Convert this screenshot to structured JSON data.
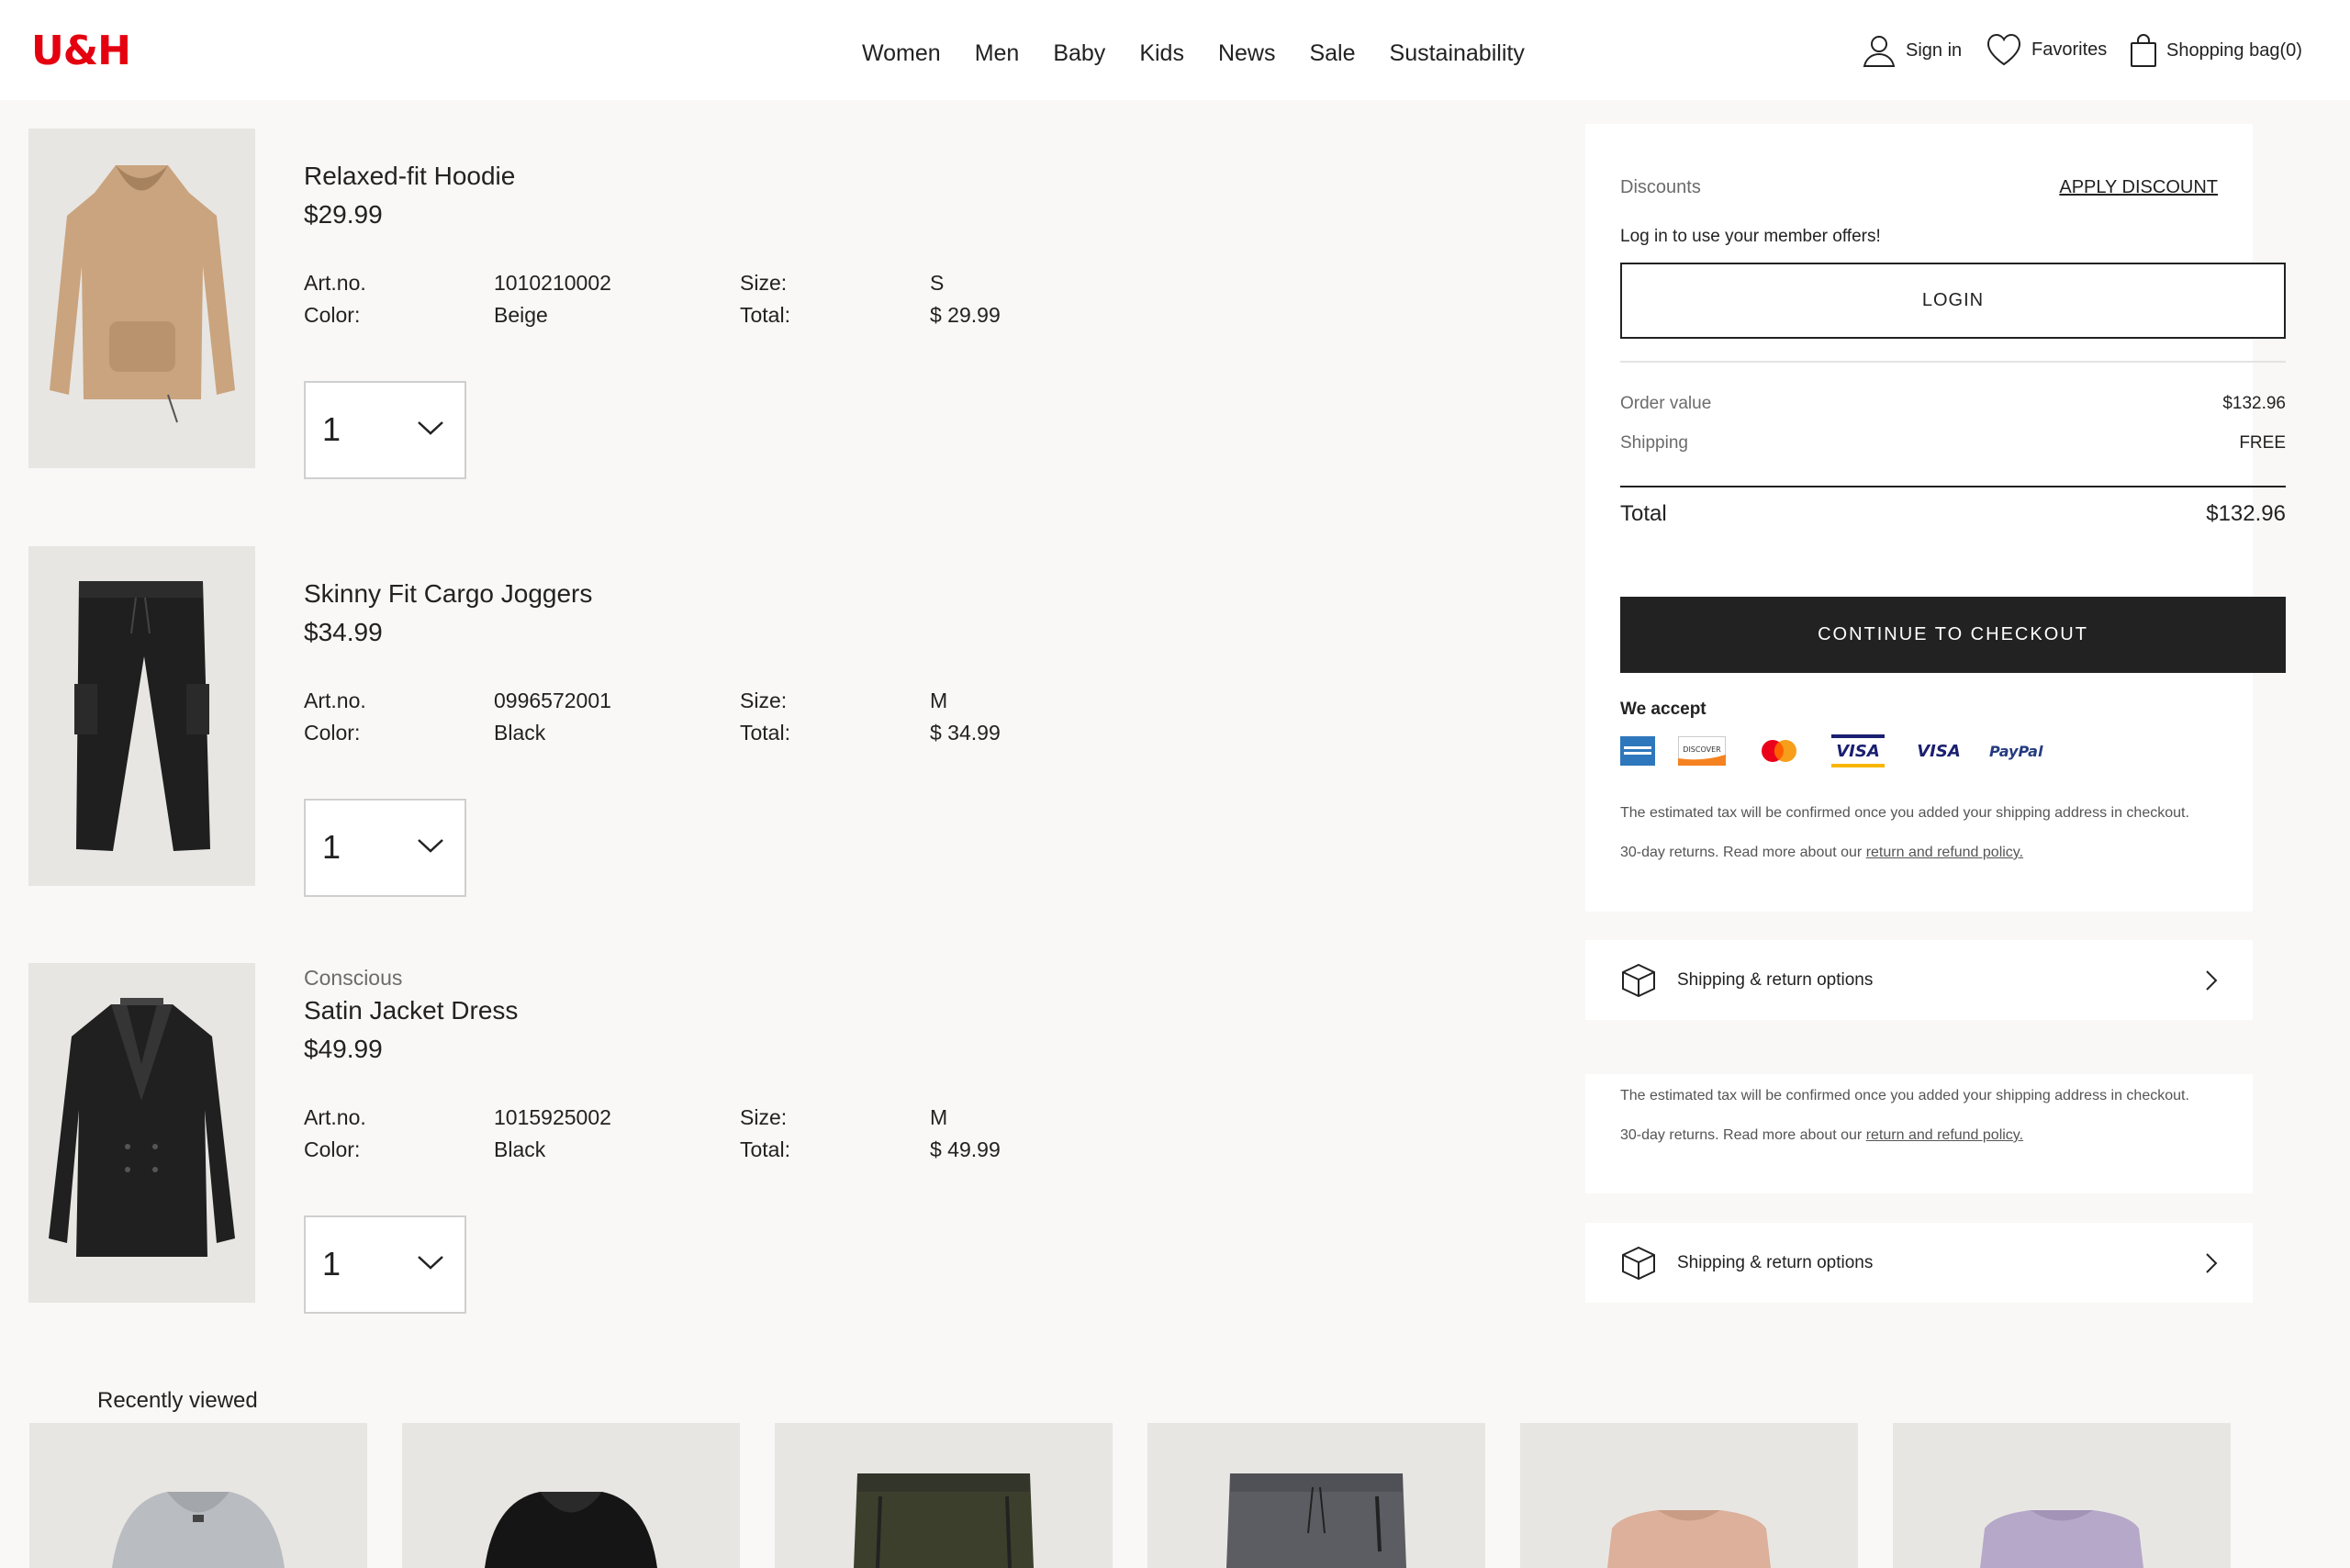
{
  "header": {
    "logo": "U&H",
    "nav": [
      "Women",
      "Men",
      "Baby",
      "Kids",
      "News",
      "Sale",
      "Sustainability"
    ],
    "sign_in": "Sign in",
    "favorites": "Favorites",
    "bag": "Shopping bag(0)"
  },
  "cart": {
    "items": [
      {
        "subtitle": "",
        "name": "Relaxed-fit Hoodie",
        "price": "$29.99",
        "artno_label": "Art.no.",
        "artno": "1010210002",
        "color_label": "Color:",
        "color": "Beige",
        "size_label": "Size:",
        "size": "S",
        "total_label": "Total:",
        "total": "$ 29.99",
        "qty": "1",
        "image_color": "#c9a47e"
      },
      {
        "subtitle": "",
        "name": "Skinny Fit Cargo Joggers",
        "price": "$34.99",
        "artno_label": "Art.no.",
        "artno": "0996572001",
        "color_label": "Color:",
        "color": "Black",
        "size_label": "Size:",
        "size": "M",
        "total_label": "Total:",
        "total": "$ 34.99",
        "qty": "1",
        "image_color": "#1f1f1f"
      },
      {
        "subtitle": "Conscious",
        "name": "Satin Jacket Dress",
        "price": "$49.99",
        "artno_label": "Art.no.",
        "artno": "1015925002",
        "color_label": "Color:",
        "color": "Black",
        "size_label": "Size:",
        "size": "M",
        "total_label": "Total:",
        "total": "$ 49.99",
        "qty": "1",
        "image_color": "#202020"
      }
    ]
  },
  "summary": {
    "discounts_label": "Discounts",
    "apply_discount": "APPLY DISCOUNT",
    "member_text": "Log in to use your member offers!",
    "login": "LOGIN",
    "order_value_label": "Order value",
    "order_value": "$132.96",
    "shipping_label": "Shipping",
    "shipping_value": "FREE",
    "total_label": "Total",
    "total_value": "$132.96",
    "checkout": "CONTINUE TO CHECKOUT",
    "we_accept": "We accept",
    "payment_icons": [
      "amex-icon",
      "discover-icon",
      "mastercard-icon",
      "visa-electron-icon",
      "visa-icon",
      "paypal-icon"
    ],
    "discover_text": "DISCOVER",
    "visa_text": "VISA",
    "paypal_text": "PayPal",
    "tax_note": "The estimated tax will be confirmed once you added your shipping address in checkout.",
    "returns_prefix": "30-day returns. Read more about our ",
    "returns_link": "return and refund policy."
  },
  "info_box": {
    "shipping_options": "Shipping & return options"
  },
  "recently_viewed": {
    "title": "Recently viewed",
    "items": [
      {
        "color": "#b9bcc0",
        "icon": "hoodie-gray"
      },
      {
        "color": "#151515",
        "icon": "hoodie-black"
      },
      {
        "color": "#3d3f2d",
        "icon": "pants-olive"
      },
      {
        "color": "#5c5d62",
        "icon": "pants-gray"
      },
      {
        "color": "#dcb09a",
        "icon": "tshirt-peach"
      },
      {
        "color": "#b6a8c8",
        "icon": "tshirt-lilac"
      }
    ]
  },
  "colors": {
    "brand_red": "#e50010",
    "checkout_bg": "#222222",
    "page_bg": "#f9f8f6"
  }
}
